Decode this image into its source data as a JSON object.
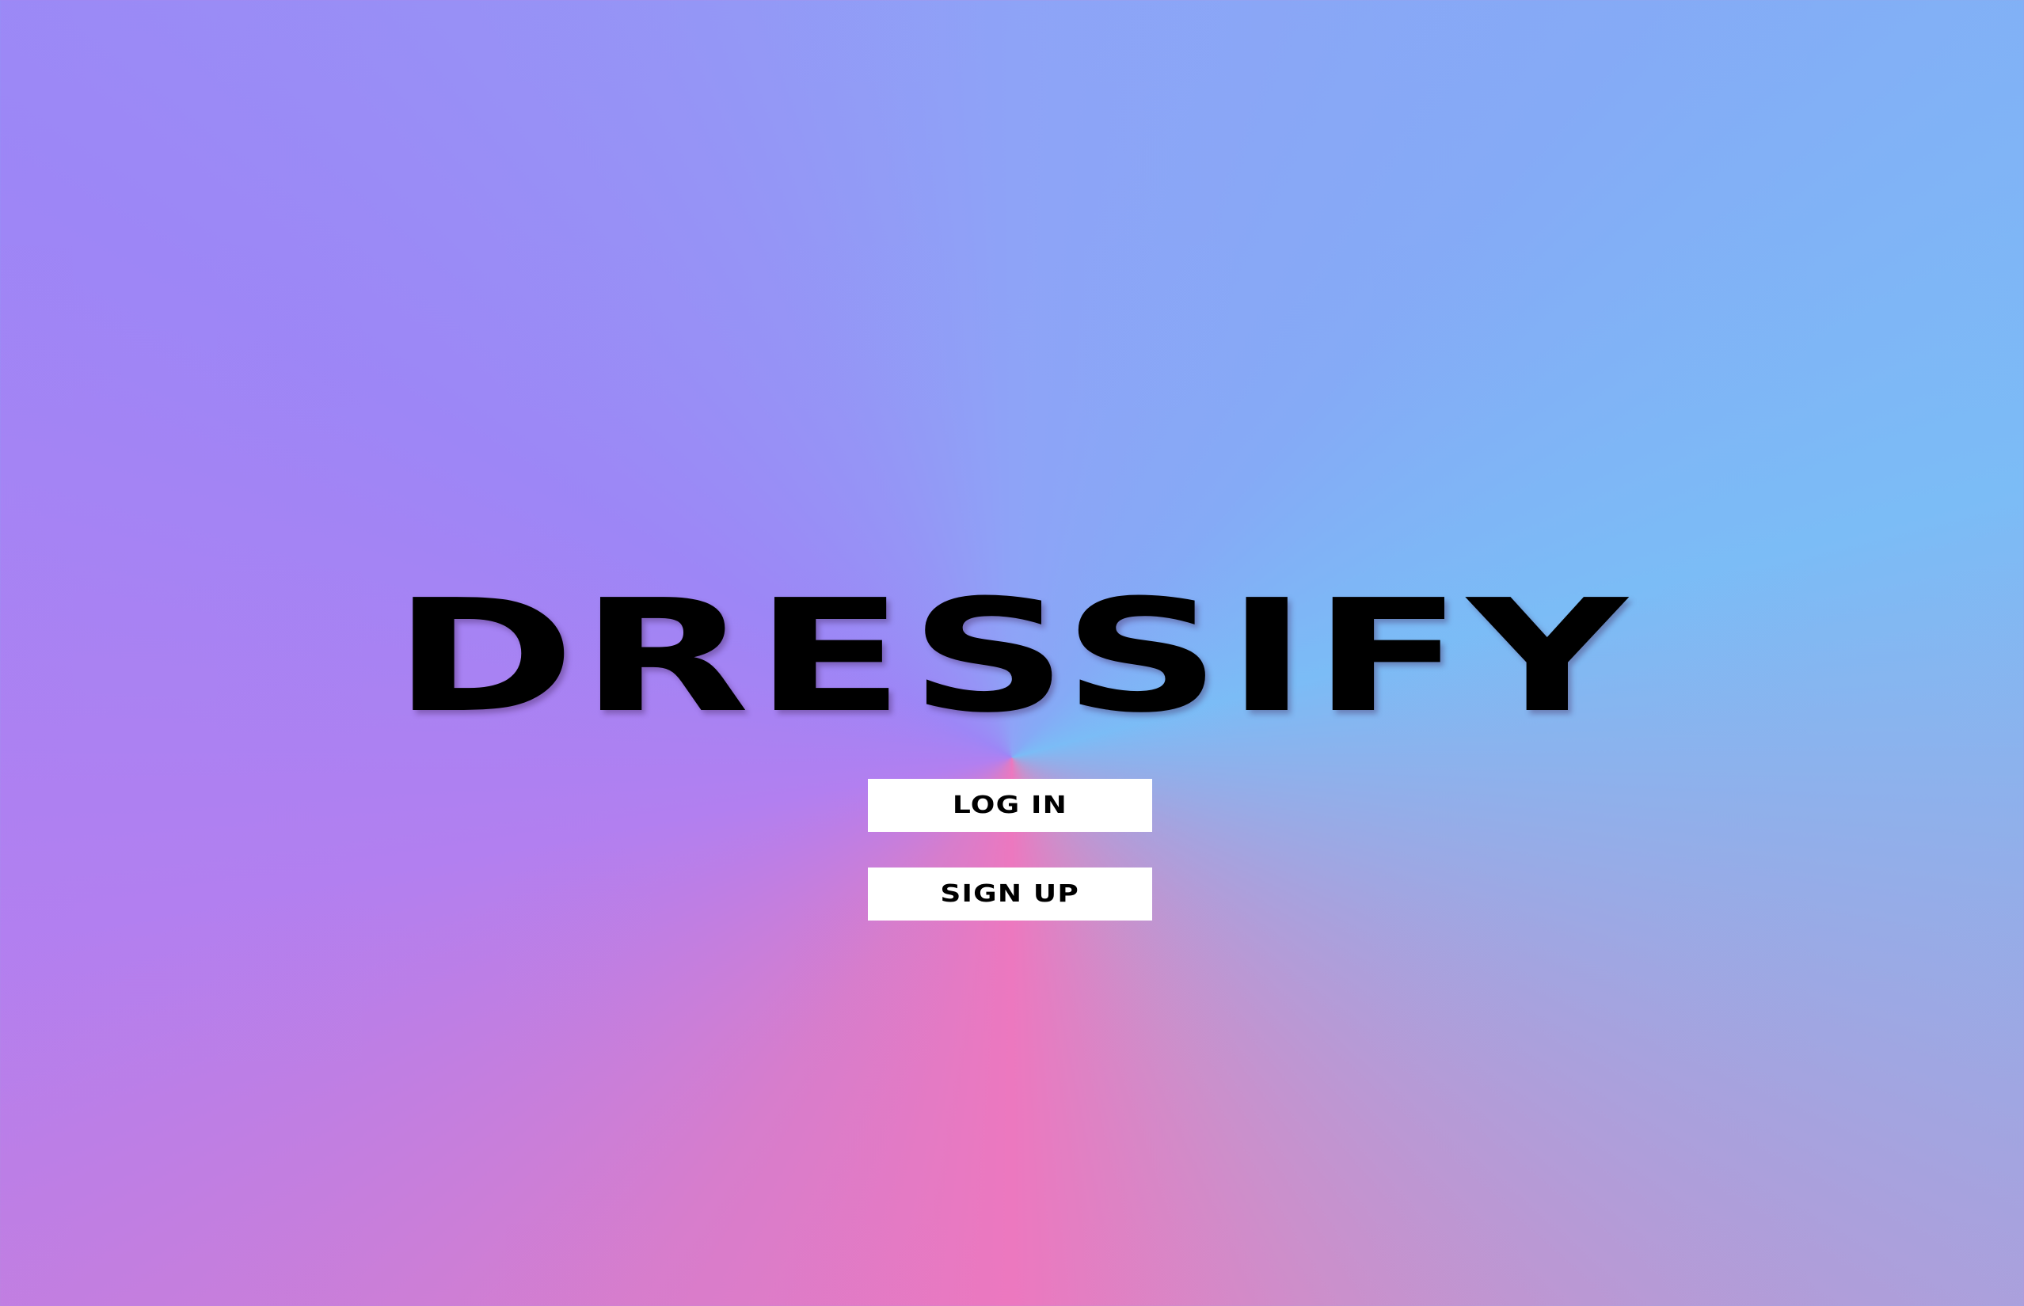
{
  "app": {
    "title": "DRESSIFY"
  },
  "actions": {
    "login_label": "LOG IN",
    "signup_label": "SIGN UP"
  },
  "colors": {
    "button_background": "#ffffff",
    "text": "#000000",
    "gradient_pink": "#ec78bf",
    "gradient_blue": "#7bbcf6",
    "gradient_purple": "#9d86f6"
  }
}
